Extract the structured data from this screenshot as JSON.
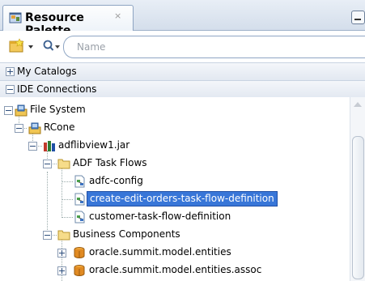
{
  "panel": {
    "tab_title": "Resource Palette",
    "tab_close": "×"
  },
  "toolbar": {
    "search_placeholder": "Name"
  },
  "sections": {
    "my_catalogs": "My Catalogs",
    "ide_connections": "IDE Connections"
  },
  "tree": {
    "file_system": "File System",
    "rcone": "RCone",
    "jar": "adflibview1.jar",
    "adf_task_flows": "ADF Task Flows",
    "adfc_config": "adfc-config",
    "create_edit": "create-edit-orders-task-flow-definition",
    "customer_tf": "customer-task-flow-definition",
    "business_components": "Business Components",
    "entities": "oracle.summit.model.entities",
    "entities_assoc": "oracle.summit.model.entities.assoc"
  }
}
